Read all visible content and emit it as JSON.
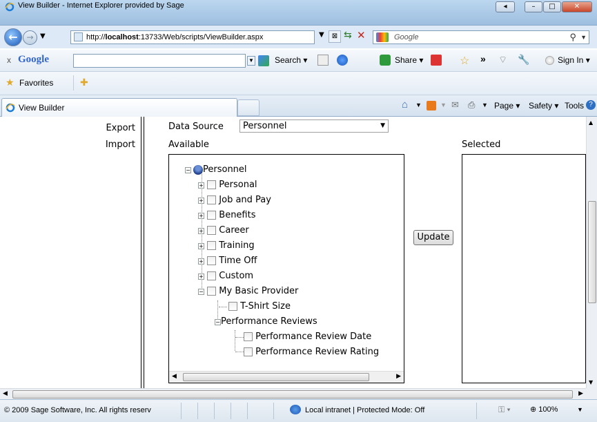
{
  "window": {
    "title": "View Builder - Internet Explorer provided by Sage",
    "buttons": {
      "back": "◂",
      "minimize": "–",
      "maximize": "□",
      "close": "✕"
    }
  },
  "address_bar": {
    "url_prefix": "http://",
    "url_host": "localhost",
    "url_rest": ":13733/Web/scripts/ViewBuilder.aspx",
    "search_placeholder": "Google"
  },
  "google_toolbar": {
    "close": "x",
    "brand": "Google",
    "search_label": "Search",
    "share_label": "Share",
    "more": "»",
    "sign_in": "Sign In"
  },
  "favorites_bar": {
    "label": "Favorites"
  },
  "tabs": {
    "active_label": "View Builder",
    "command_bar": {
      "page": "Page",
      "safety": "Safety",
      "tools": "Tools"
    }
  },
  "left_pane": {
    "links": [
      "Export",
      "Import"
    ]
  },
  "form": {
    "data_source_label": "Data Source",
    "data_source_value": "Personnel",
    "available_label": "Available",
    "selected_label": "Selected",
    "update_button": "Update"
  },
  "tree": {
    "root": "Personnel",
    "items": [
      "Personal",
      "Job and Pay",
      "Benefits",
      "Career",
      "Training",
      "Time Off",
      "Custom",
      "My Basic Provider"
    ],
    "provider_child": "T-Shirt Size",
    "reviews_group": "Performance Reviews",
    "reviews_children": [
      "Performance Review Date",
      "Performance Review Rating"
    ]
  },
  "status_bar": {
    "copyright": "© 2009 Sage Software, Inc. All rights reserv",
    "zone": "Local intranet | Protected Mode: Off",
    "zoom": "100%"
  },
  "colors": {
    "titlebar": "#bcd7ef",
    "close_button": "#c8462a",
    "accent_blue": "#1c58b8"
  }
}
